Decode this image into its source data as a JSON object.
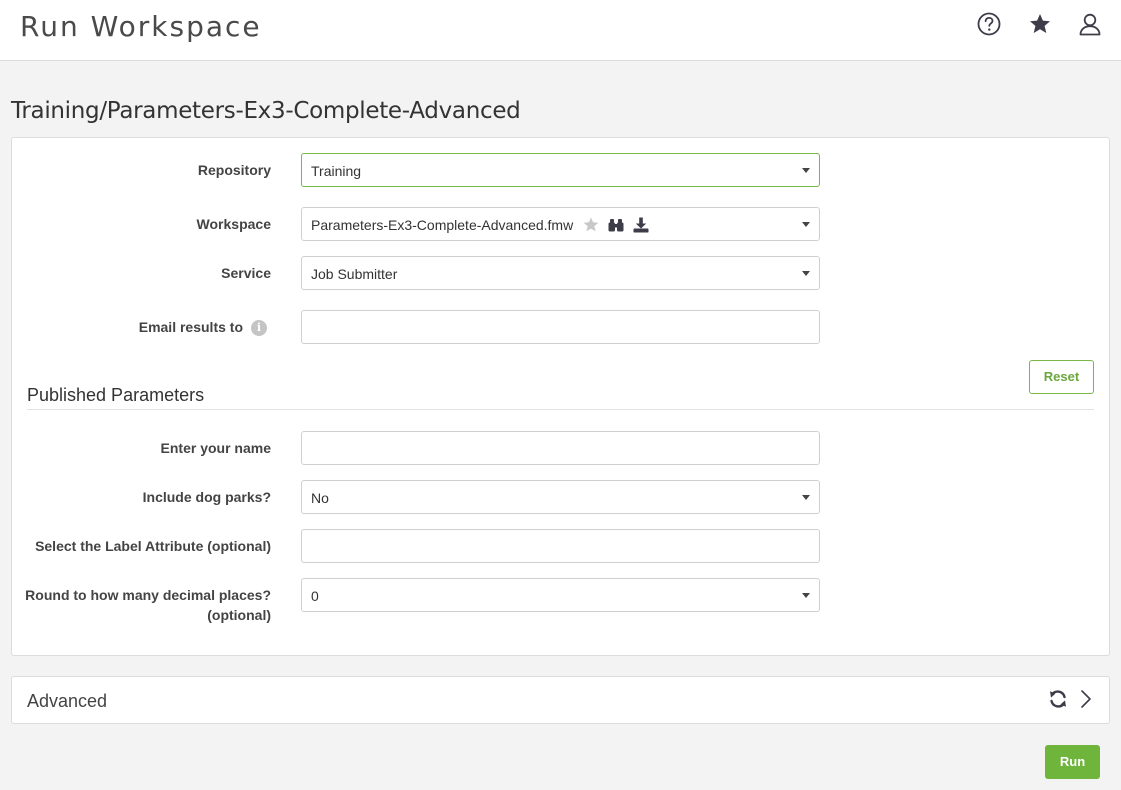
{
  "header": {
    "app_title": "Run Workspace",
    "icons": [
      "help-icon",
      "star-icon",
      "user-icon"
    ]
  },
  "page": {
    "heading": "Training/Parameters-Ex3-Complete-Advanced"
  },
  "form": {
    "repository": {
      "label": "Repository",
      "value": "Training"
    },
    "workspace": {
      "label": "Workspace",
      "value": "Parameters-Ex3-Complete-Advanced.fmw",
      "icons": [
        "star-icon",
        "binoculars-icon",
        "download-icon"
      ]
    },
    "service": {
      "label": "Service",
      "value": "Job Submitter"
    },
    "email": {
      "label": "Email results to",
      "value": "",
      "icon": "info-icon"
    },
    "reset_label": "Reset"
  },
  "published": {
    "title": "Published Parameters",
    "name": {
      "label": "Enter your name",
      "value": ""
    },
    "dog_parks": {
      "label": "Include dog parks?",
      "value": "No"
    },
    "label_attr": {
      "label": "Select the Label Attribute (optional)",
      "value": ""
    },
    "decimals": {
      "label_line1": "Round to how many decimal places?",
      "label_line2": "(optional)",
      "value": "0"
    }
  },
  "advanced": {
    "title": "Advanced",
    "icons": [
      "refresh-icon",
      "chevron-right-icon"
    ]
  },
  "run_label": "Run",
  "colors": {
    "accent_green": "#6fb43b",
    "active_border": "#7ab648",
    "icon_dark": "#3d3d4a"
  }
}
